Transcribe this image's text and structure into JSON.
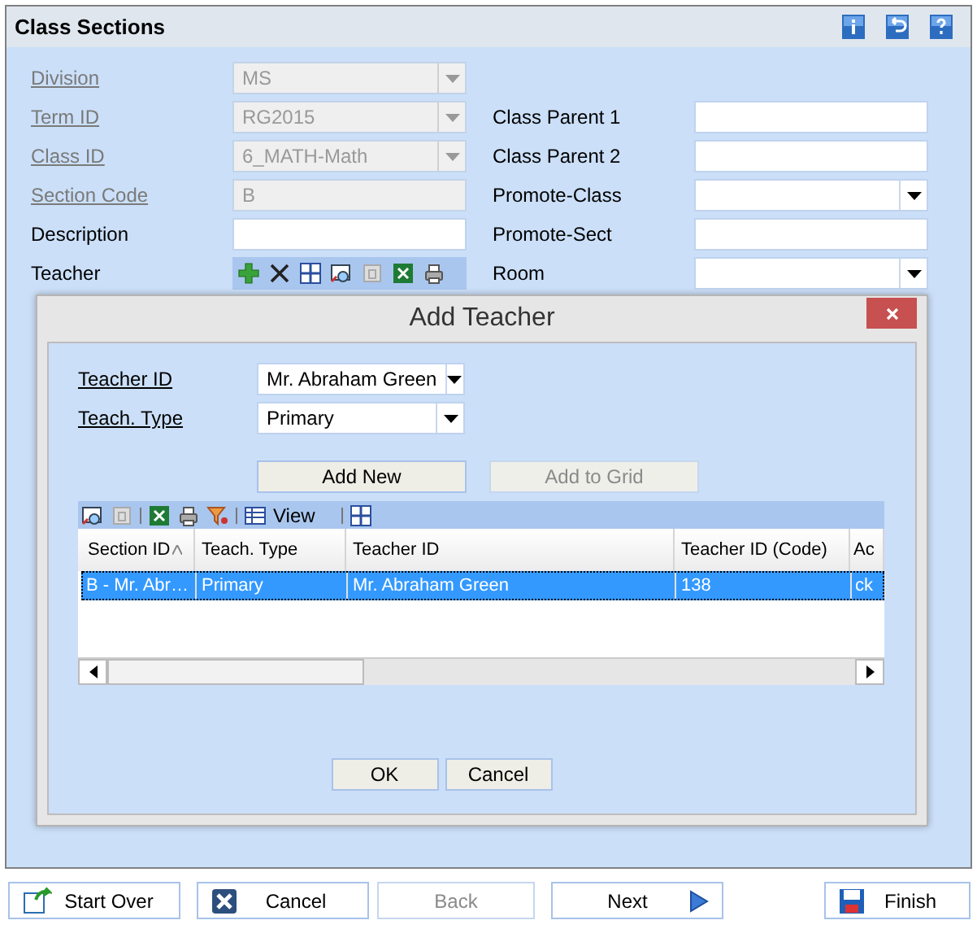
{
  "window": {
    "title": "Class Sections"
  },
  "left_fields": [
    {
      "label": "Division",
      "underlined": true,
      "disabled": true,
      "kind": "select",
      "value": "MS"
    },
    {
      "label": "Term ID",
      "underlined": true,
      "disabled": true,
      "kind": "select",
      "value": "RG2015"
    },
    {
      "label": "Class ID",
      "underlined": true,
      "disabled": true,
      "kind": "select",
      "value": "6_MATH-Math"
    },
    {
      "label": "Section Code",
      "underlined": true,
      "disabled": true,
      "kind": "input",
      "value": "B"
    },
    {
      "label": "Description",
      "underlined": false,
      "disabled": false,
      "kind": "input"
    },
    {
      "label": "Teacher",
      "underlined": false,
      "disabled": false,
      "kind": "toolbar"
    }
  ],
  "right_fields": [
    {
      "label": "Class Parent 1",
      "kind": "input"
    },
    {
      "label": "Class Parent 2",
      "kind": "input"
    },
    {
      "label": "Promote-Class",
      "kind": "select"
    },
    {
      "label": "Promote-Sect",
      "kind": "input"
    },
    {
      "label": "Room",
      "kind": "select"
    }
  ],
  "dialog": {
    "title": "Add Teacher",
    "fields": [
      {
        "label": "Teacher ID",
        "value": "Mr. Abraham Green"
      },
      {
        "label": "Teach. Type",
        "value": "Primary"
      }
    ],
    "buttons": [
      {
        "label": "Add New",
        "disabled": false
      },
      {
        "label": "Add to Grid",
        "disabled": true
      }
    ],
    "grid_toolbar": {
      "view_label": "View"
    },
    "table": {
      "columns": [
        "Section ID",
        "Teach. Type",
        "Teacher ID",
        "Teacher ID (Code)",
        "Ac"
      ],
      "rows": [
        {
          "cells": [
            "B - Mr. Abr…",
            "Primary",
            "Mr. Abraham Green",
            "138",
            "ck"
          ],
          "selected": true
        }
      ]
    },
    "footer_buttons": [
      "OK",
      "Cancel"
    ]
  },
  "footer": [
    {
      "label": "Start Over",
      "kind": "restart",
      "disabled": false
    },
    {
      "label": "Cancel",
      "kind": "cancel",
      "disabled": false
    },
    {
      "label": "Back",
      "kind": "plain",
      "disabled": true
    },
    {
      "label": "Next",
      "kind": "next",
      "disabled": false
    },
    {
      "label": "Finish",
      "kind": "save",
      "disabled": false
    }
  ]
}
